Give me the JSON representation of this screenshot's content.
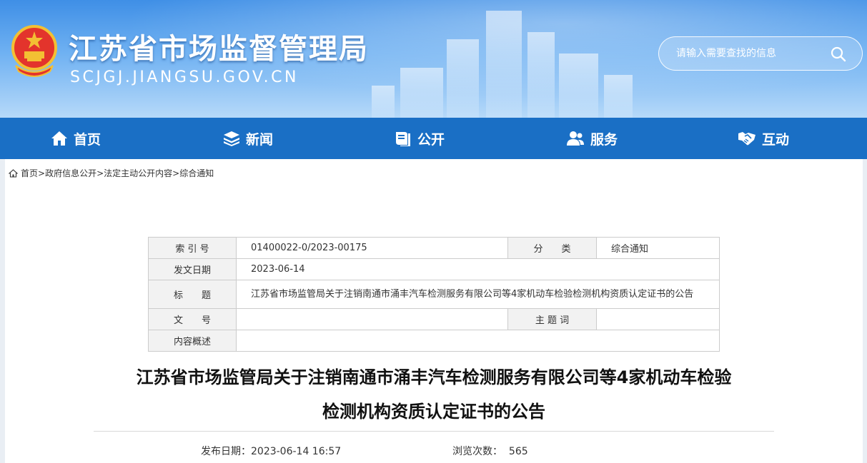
{
  "header": {
    "site_title": "江苏省市场监督管理局",
    "site_domain": "SCJGJ.JIANGSU.GOV.CN",
    "search_placeholder": "请输入需要查找的信息",
    "brand_color": "#1a6fc5"
  },
  "nav": {
    "items": [
      {
        "label": "首页",
        "icon": "home-icon"
      },
      {
        "label": "新闻",
        "icon": "layers-icon"
      },
      {
        "label": "公开",
        "icon": "book-icon"
      },
      {
        "label": "服务",
        "icon": "user-icon"
      },
      {
        "label": "互动",
        "icon": "handshake-icon"
      }
    ]
  },
  "breadcrumb": {
    "icon": "home-icon",
    "items": [
      "首页",
      "政府信息公开",
      "法定主动公开内容",
      "综合通知"
    ],
    "separator": ">"
  },
  "meta_table": {
    "index_label": "索 引 号",
    "index_value": "01400022-0/2023-00175",
    "category_label": "分　　类",
    "category_value": "综合通知",
    "date_label": "发文日期",
    "date_value": "2023-06-14",
    "title_label": "标　　题",
    "title_value": "江苏省市场监管局关于注销南通市涌丰汽车检测服务有限公司等4家机动车检验检测机构资质认定证书的公告",
    "docno_label": "文　　号",
    "docno_value": "",
    "keywords_label": "主 题 词",
    "keywords_value": "",
    "summary_label": "内容概述",
    "summary_value": ""
  },
  "article": {
    "title_line1": "江苏省市场监管局关于注销南通市涌丰汽车检测服务有限公司等4家机动车检验",
    "title_line2": "检测机构资质认定证书的公告",
    "publish_label": "发布日期：",
    "publish_value": "2023-06-14 16:57",
    "views_label": "浏览次数：",
    "views_value": "565"
  }
}
